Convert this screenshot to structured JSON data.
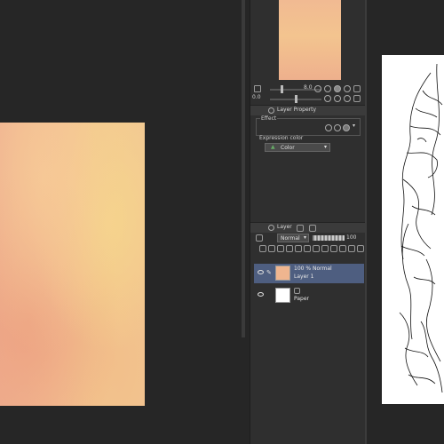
{
  "canvas": {
    "left_image_name": "watercolor-texture"
  },
  "navigator": {
    "zoom_value": "8.0",
    "rotate_value": "0.0"
  },
  "layer_property": {
    "tab_label": "Layer Property",
    "effect_label": "Effect",
    "expression_color_label": "Expression color",
    "color_dropdown": "Color"
  },
  "layer_panel": {
    "tab_label": "Layer",
    "blend_mode": "Normal",
    "opacity": "100",
    "layers": [
      {
        "line1": "100 % Normal",
        "line2": "Layer 1",
        "selected": true,
        "thumb_color": "#efb58f"
      },
      {
        "line1": "",
        "line2": "Paper",
        "selected": false,
        "thumb_color": "#ffffff"
      }
    ]
  },
  "colors": {
    "background": "#262626",
    "panel": "#2f2f2f",
    "selection": "#4e5e80"
  }
}
